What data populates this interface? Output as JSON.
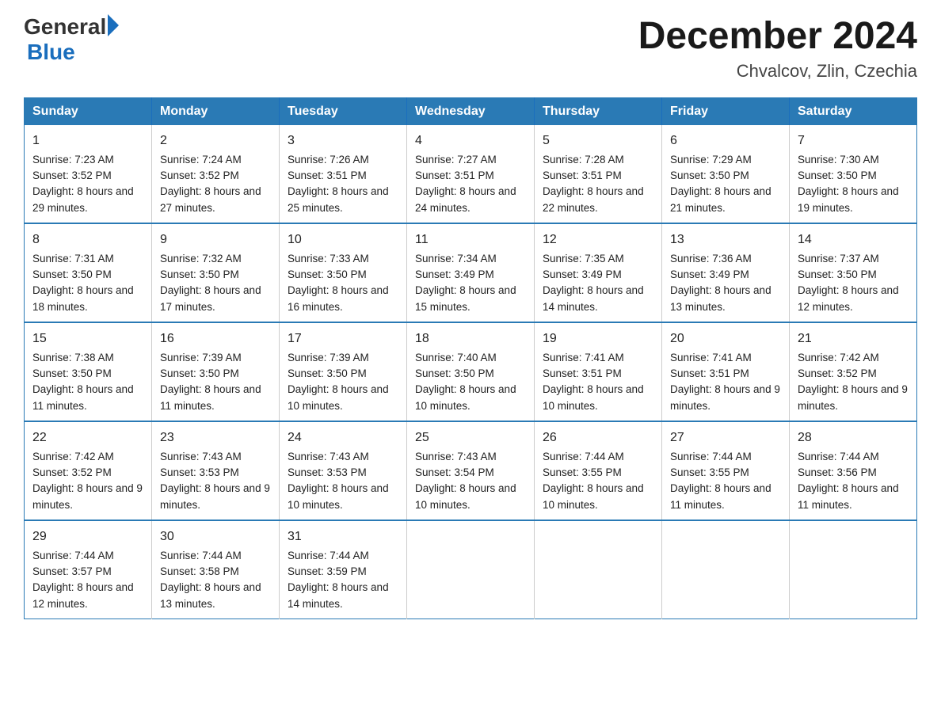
{
  "header": {
    "logo_general": "General",
    "logo_blue": "Blue",
    "month_title": "December 2024",
    "location": "Chvalcov, Zlin, Czechia"
  },
  "days_of_week": [
    "Sunday",
    "Monday",
    "Tuesday",
    "Wednesday",
    "Thursday",
    "Friday",
    "Saturday"
  ],
  "weeks": [
    [
      {
        "day": "1",
        "sunrise": "7:23 AM",
        "sunset": "3:52 PM",
        "daylight": "8 hours and 29 minutes."
      },
      {
        "day": "2",
        "sunrise": "7:24 AM",
        "sunset": "3:52 PM",
        "daylight": "8 hours and 27 minutes."
      },
      {
        "day": "3",
        "sunrise": "7:26 AM",
        "sunset": "3:51 PM",
        "daylight": "8 hours and 25 minutes."
      },
      {
        "day": "4",
        "sunrise": "7:27 AM",
        "sunset": "3:51 PM",
        "daylight": "8 hours and 24 minutes."
      },
      {
        "day": "5",
        "sunrise": "7:28 AM",
        "sunset": "3:51 PM",
        "daylight": "8 hours and 22 minutes."
      },
      {
        "day": "6",
        "sunrise": "7:29 AM",
        "sunset": "3:50 PM",
        "daylight": "8 hours and 21 minutes."
      },
      {
        "day": "7",
        "sunrise": "7:30 AM",
        "sunset": "3:50 PM",
        "daylight": "8 hours and 19 minutes."
      }
    ],
    [
      {
        "day": "8",
        "sunrise": "7:31 AM",
        "sunset": "3:50 PM",
        "daylight": "8 hours and 18 minutes."
      },
      {
        "day": "9",
        "sunrise": "7:32 AM",
        "sunset": "3:50 PM",
        "daylight": "8 hours and 17 minutes."
      },
      {
        "day": "10",
        "sunrise": "7:33 AM",
        "sunset": "3:50 PM",
        "daylight": "8 hours and 16 minutes."
      },
      {
        "day": "11",
        "sunrise": "7:34 AM",
        "sunset": "3:49 PM",
        "daylight": "8 hours and 15 minutes."
      },
      {
        "day": "12",
        "sunrise": "7:35 AM",
        "sunset": "3:49 PM",
        "daylight": "8 hours and 14 minutes."
      },
      {
        "day": "13",
        "sunrise": "7:36 AM",
        "sunset": "3:49 PM",
        "daylight": "8 hours and 13 minutes."
      },
      {
        "day": "14",
        "sunrise": "7:37 AM",
        "sunset": "3:50 PM",
        "daylight": "8 hours and 12 minutes."
      }
    ],
    [
      {
        "day": "15",
        "sunrise": "7:38 AM",
        "sunset": "3:50 PM",
        "daylight": "8 hours and 11 minutes."
      },
      {
        "day": "16",
        "sunrise": "7:39 AM",
        "sunset": "3:50 PM",
        "daylight": "8 hours and 11 minutes."
      },
      {
        "day": "17",
        "sunrise": "7:39 AM",
        "sunset": "3:50 PM",
        "daylight": "8 hours and 10 minutes."
      },
      {
        "day": "18",
        "sunrise": "7:40 AM",
        "sunset": "3:50 PM",
        "daylight": "8 hours and 10 minutes."
      },
      {
        "day": "19",
        "sunrise": "7:41 AM",
        "sunset": "3:51 PM",
        "daylight": "8 hours and 10 minutes."
      },
      {
        "day": "20",
        "sunrise": "7:41 AM",
        "sunset": "3:51 PM",
        "daylight": "8 hours and 9 minutes."
      },
      {
        "day": "21",
        "sunrise": "7:42 AM",
        "sunset": "3:52 PM",
        "daylight": "8 hours and 9 minutes."
      }
    ],
    [
      {
        "day": "22",
        "sunrise": "7:42 AM",
        "sunset": "3:52 PM",
        "daylight": "8 hours and 9 minutes."
      },
      {
        "day": "23",
        "sunrise": "7:43 AM",
        "sunset": "3:53 PM",
        "daylight": "8 hours and 9 minutes."
      },
      {
        "day": "24",
        "sunrise": "7:43 AM",
        "sunset": "3:53 PM",
        "daylight": "8 hours and 10 minutes."
      },
      {
        "day": "25",
        "sunrise": "7:43 AM",
        "sunset": "3:54 PM",
        "daylight": "8 hours and 10 minutes."
      },
      {
        "day": "26",
        "sunrise": "7:44 AM",
        "sunset": "3:55 PM",
        "daylight": "8 hours and 10 minutes."
      },
      {
        "day": "27",
        "sunrise": "7:44 AM",
        "sunset": "3:55 PM",
        "daylight": "8 hours and 11 minutes."
      },
      {
        "day": "28",
        "sunrise": "7:44 AM",
        "sunset": "3:56 PM",
        "daylight": "8 hours and 11 minutes."
      }
    ],
    [
      {
        "day": "29",
        "sunrise": "7:44 AM",
        "sunset": "3:57 PM",
        "daylight": "8 hours and 12 minutes."
      },
      {
        "day": "30",
        "sunrise": "7:44 AM",
        "sunset": "3:58 PM",
        "daylight": "8 hours and 13 minutes."
      },
      {
        "day": "31",
        "sunrise": "7:44 AM",
        "sunset": "3:59 PM",
        "daylight": "8 hours and 14 minutes."
      },
      null,
      null,
      null,
      null
    ]
  ]
}
